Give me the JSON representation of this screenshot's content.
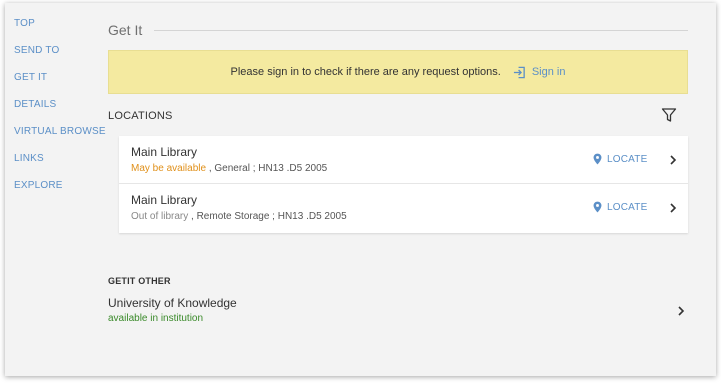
{
  "sidebar": {
    "items": [
      {
        "label": "TOP"
      },
      {
        "label": "SEND TO"
      },
      {
        "label": "GET IT"
      },
      {
        "label": "DETAILS"
      },
      {
        "label": "VIRTUAL BROWSE"
      },
      {
        "label": "LINKS"
      },
      {
        "label": "EXPLORE"
      }
    ]
  },
  "section": {
    "title": "Get It"
  },
  "signin_banner": {
    "message": "Please sign in to check if there are any request options.",
    "link_label": "Sign in",
    "icon": "sign-in-icon",
    "background": "#f4eaa0"
  },
  "locations": {
    "label": "LOCATIONS",
    "filter_icon": "filter-icon",
    "items": [
      {
        "name": "Main Library",
        "status": "May be available",
        "detail": ", General ; HN13 .D5 2005",
        "status_color": "#e0901a",
        "locate_label": "LOCATE"
      },
      {
        "name": "Main Library",
        "status": "Out of library",
        "detail": ", Remote Storage ; HN13 .D5 2005",
        "status_color": "#888888",
        "locate_label": "LOCATE"
      }
    ]
  },
  "getit_other": {
    "label": "GETIT OTHER",
    "item": {
      "name": "University of Knowledge",
      "status": "available in institution",
      "status_color": "#3a8a2a"
    }
  },
  "colors": {
    "link": "#5b8fc7",
    "panel_background": "#f3f3f3"
  }
}
